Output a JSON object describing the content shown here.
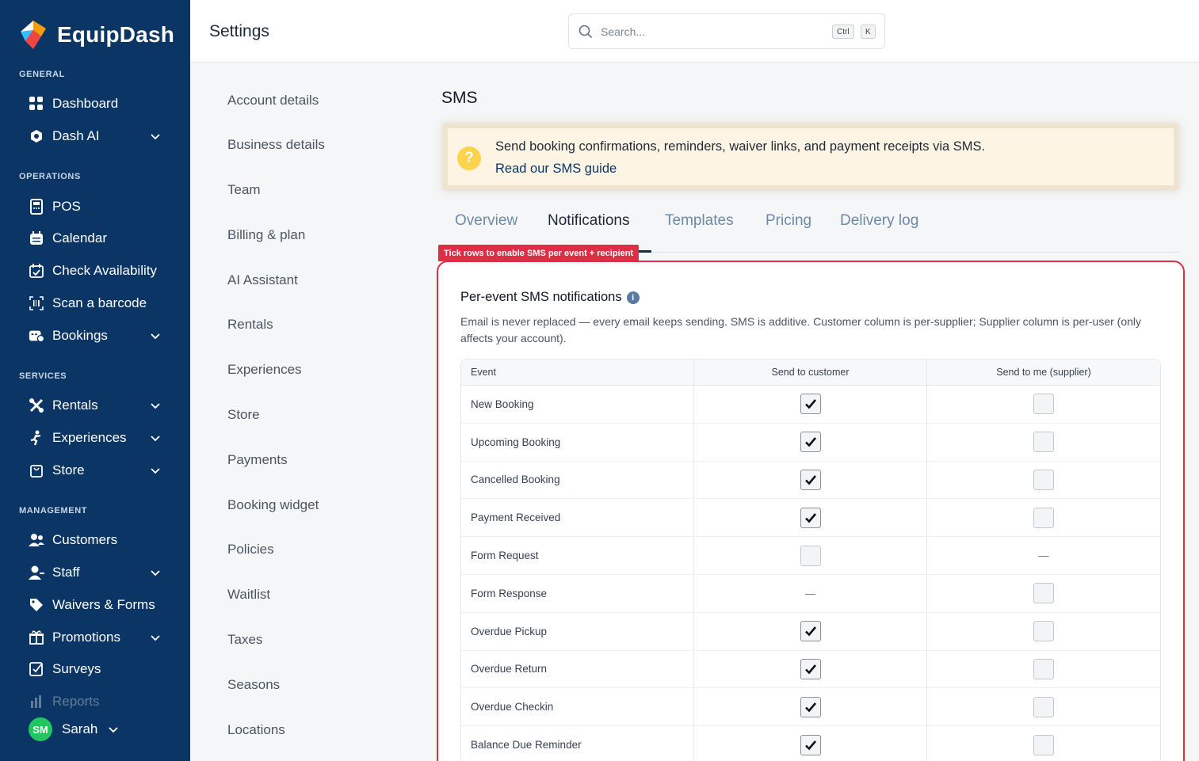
{
  "brand": {
    "name": "EquipDash"
  },
  "sidebar": {
    "sections": [
      {
        "label": "GENERAL"
      },
      {
        "label": "OPERATIONS"
      },
      {
        "label": "SERVICES"
      },
      {
        "label": "MANAGEMENT"
      }
    ],
    "items": [
      {
        "label": "Dashboard",
        "icon": "grid-icon"
      },
      {
        "label": "Dash AI",
        "icon": "ai-hexagon-icon",
        "expandable": true
      },
      {
        "label": "POS",
        "icon": "pos-terminal-icon"
      },
      {
        "label": "Calendar",
        "icon": "calendar-icon"
      },
      {
        "label": "Check Availability",
        "icon": "calendar-check-icon"
      },
      {
        "label": "Scan a barcode",
        "icon": "barcode-scan-icon"
      },
      {
        "label": "Bookings",
        "icon": "bookings-icon",
        "expandable": true
      },
      {
        "label": "Rentals",
        "icon": "tools-icon",
        "expandable": true
      },
      {
        "label": "Experiences",
        "icon": "climber-icon",
        "expandable": true
      },
      {
        "label": "Store",
        "icon": "shopping-bag-icon",
        "expandable": true
      },
      {
        "label": "Customers",
        "icon": "customers-icon"
      },
      {
        "label": "Staff",
        "icon": "staff-icon",
        "expandable": true
      },
      {
        "label": "Waivers & Forms",
        "icon": "tag-icon"
      },
      {
        "label": "Promotions",
        "icon": "gift-icon",
        "expandable": true
      },
      {
        "label": "Surveys",
        "icon": "survey-icon"
      },
      {
        "label": "Reports",
        "icon": "reports-icon"
      }
    ],
    "user": {
      "initials": "SM",
      "name": "Sarah"
    }
  },
  "header": {
    "title": "Settings",
    "search": {
      "placeholder": "Search...",
      "shortcut_ctrl": "Ctrl",
      "shortcut_key": "K"
    }
  },
  "settings_nav": [
    "Account details",
    "Business details",
    "Team",
    "Billing & plan",
    "AI Assistant",
    "Rentals",
    "Experiences",
    "Store",
    "Payments",
    "Booking widget",
    "Policies",
    "Waitlist",
    "Taxes",
    "Seasons",
    "Locations"
  ],
  "main": {
    "title": "SMS",
    "callout": {
      "icon": "question-icon",
      "message": "Send booking confirmations, reminders, waiver links, and payment receipts via SMS.",
      "link": "Read our SMS guide"
    },
    "tabs": [
      {
        "label": "Overview",
        "active": false
      },
      {
        "label": "Notifications",
        "active": true
      },
      {
        "label": "Templates",
        "active": false
      },
      {
        "label": "Pricing",
        "active": false
      },
      {
        "label": "Delivery log",
        "active": false
      }
    ],
    "flag": "Tick rows to enable SMS per event + recipient",
    "card": {
      "title": "Per-event SMS notifications",
      "description": "Email is never replaced — every email keeps sending. SMS is additive. Customer column is per-supplier; Supplier column is per-user (only affects your account).",
      "columns": [
        "Event",
        "Send to customer",
        "Send to me (supplier)"
      ],
      "rows": [
        {
          "event": "New Booking",
          "customer": "checked",
          "supplier": "unchecked"
        },
        {
          "event": "Upcoming Booking",
          "customer": "checked",
          "supplier": "unchecked"
        },
        {
          "event": "Cancelled Booking",
          "customer": "checked",
          "supplier": "unchecked"
        },
        {
          "event": "Payment Received",
          "customer": "checked",
          "supplier": "unchecked"
        },
        {
          "event": "Form Request",
          "customer": "unchecked",
          "supplier": "—"
        },
        {
          "event": "Form Response",
          "customer": "—",
          "supplier": "unchecked"
        },
        {
          "event": "Overdue Pickup",
          "customer": "checked",
          "supplier": "unchecked"
        },
        {
          "event": "Overdue Return",
          "customer": "checked",
          "supplier": "unchecked"
        },
        {
          "event": "Overdue Checkin",
          "customer": "checked",
          "supplier": "unchecked"
        },
        {
          "event": "Balance Due Reminder",
          "customer": "checked",
          "supplier": "unchecked"
        }
      ]
    }
  },
  "colors": {
    "sidebar_bg": "#0b3564",
    "accent_red": "#dc2f45",
    "callout_bg": "#fdf4e3",
    "avatar": "#22c55e"
  }
}
